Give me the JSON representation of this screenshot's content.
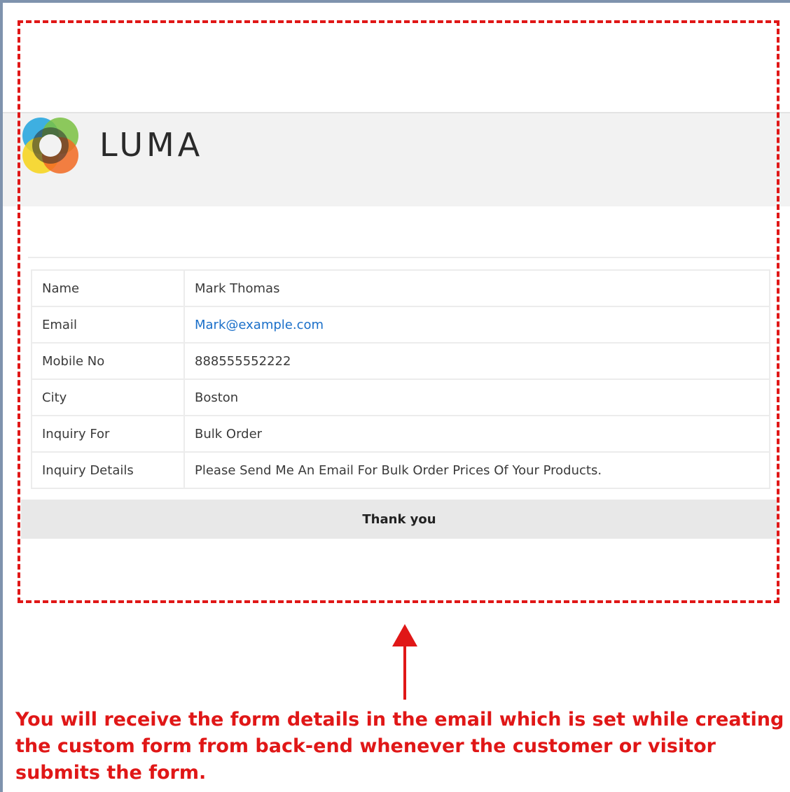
{
  "brand": {
    "name": "LUMA"
  },
  "details": [
    {
      "label": "Name",
      "value": "Mark Thomas",
      "is_link": false
    },
    {
      "label": "Email",
      "value": "Mark@example.com",
      "is_link": true
    },
    {
      "label": "Mobile No",
      "value": "888555552222",
      "is_link": false
    },
    {
      "label": "City",
      "value": "Boston",
      "is_link": false
    },
    {
      "label": "Inquiry For",
      "value": "Bulk Order",
      "is_link": false
    },
    {
      "label": "Inquiry Details",
      "value": "Please Send Me An Email For Bulk Order Prices Of Your Products.",
      "is_link": false
    }
  ],
  "footer": {
    "thanks": "Thank you"
  },
  "annotation": {
    "note": "You will receive the form details in the email which is set while creating the custom form from back-end whenever the customer or visitor submits the form."
  },
  "colors": {
    "annotation_red": "#e01717",
    "link_blue": "#1a6fc9",
    "header_gray": "#f2f2f2"
  }
}
